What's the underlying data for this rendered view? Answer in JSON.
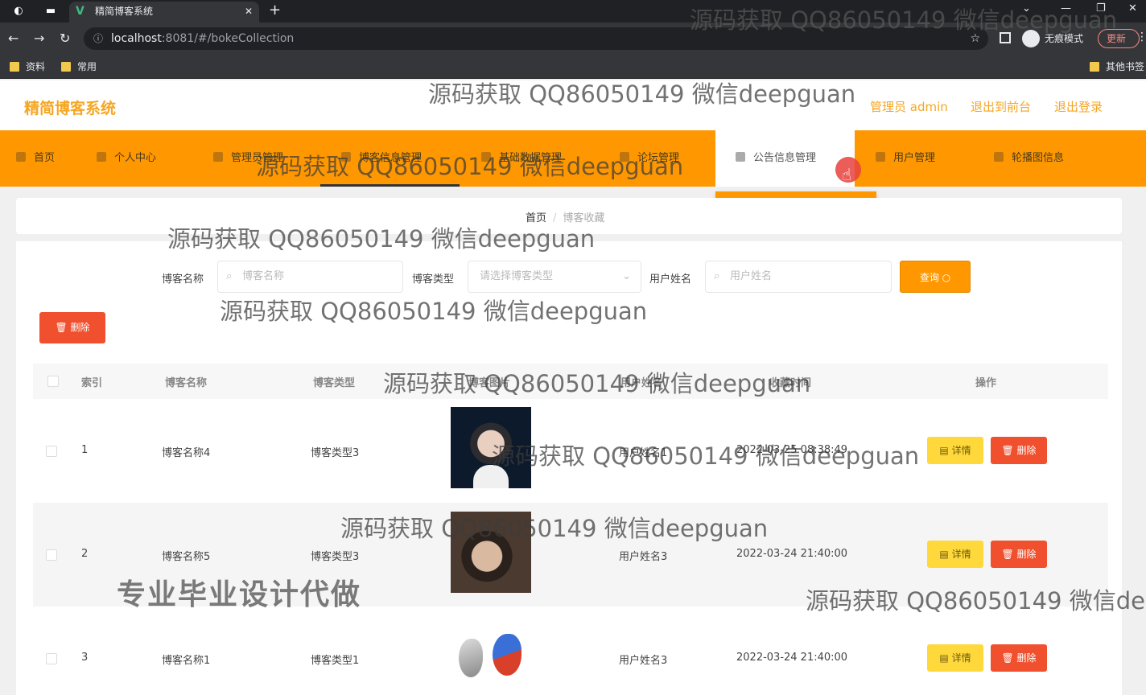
{
  "browser": {
    "tab_title": "精简博客系统",
    "tab_close": "✕",
    "new_tab": "+",
    "url_host": "localhost",
    "url_path": ":8081/#/bokeCollection",
    "incognito": "无痕模式",
    "update": "更新",
    "bookmarks": [
      "资料",
      "常用",
      "其他书签"
    ]
  },
  "header": {
    "logo": "精简博客系统",
    "admin": "管理员 admin",
    "to_front": "退出到前台",
    "logout": "退出登录"
  },
  "nav": {
    "items": [
      "首页",
      "个人中心",
      "管理员管理",
      "博客信息管理",
      "基础数据管理",
      "论坛管理",
      "公告信息管理",
      "用户管理",
      "轮播图信息"
    ],
    "active": "公告信息管理",
    "dropdown_item": "公告信息管理"
  },
  "breadcrumb": {
    "home": "首页",
    "sep": "/",
    "current": "博客收藏"
  },
  "search": {
    "name_label": "博客名称",
    "name_placeholder": "博客名称",
    "type_label": "博客类型",
    "type_placeholder": "请选择博客类型",
    "user_label": "用户姓名",
    "user_placeholder": "用户姓名",
    "query_button": "查询"
  },
  "actions": {
    "batch_delete": "删除"
  },
  "table": {
    "headers": [
      "索引",
      "博客名称",
      "博客类型",
      "博客图片",
      "用户姓名",
      "收藏时间",
      "操作"
    ],
    "rows": [
      {
        "index": "1",
        "name": "博客名称4",
        "type": "博客类型3",
        "user": "用户姓名1",
        "time": "2022-03-25 08:38:49"
      },
      {
        "index": "2",
        "name": "博客名称5",
        "type": "博客类型3",
        "user": "用户姓名3",
        "time": "2022-03-24 21:40:00"
      },
      {
        "index": "3",
        "name": "博客名称1",
        "type": "博客类型1",
        "user": "用户姓名3",
        "time": "2022-03-24 21:40:00"
      }
    ],
    "detail_label": "详情",
    "delete_label": "删除"
  },
  "watermark": {
    "text": "源码获取 QQ86050149 微信deepguan",
    "text_cut": "源码获取 QQ86050149 微信de",
    "ad": "专业毕业设计代做"
  },
  "colors": {
    "accent": "#ff9800",
    "danger": "#f0502e",
    "warning": "#ffd83b",
    "logo": "#f5a623"
  }
}
